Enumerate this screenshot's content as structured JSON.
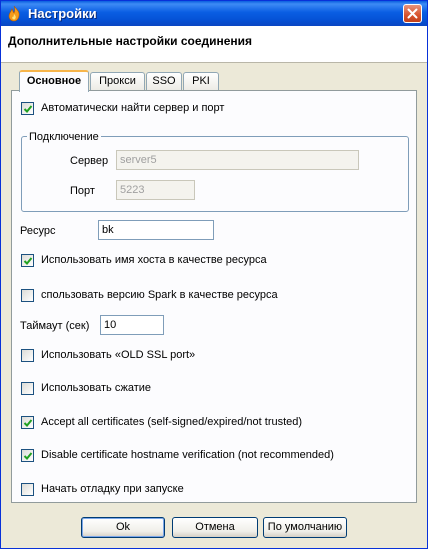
{
  "window": {
    "title": "Настройки"
  },
  "header": {
    "title": "Дополнительные настройки соединения"
  },
  "tabs": [
    {
      "label": "Основное"
    },
    {
      "label": "Прокси"
    },
    {
      "label": "SSO"
    },
    {
      "label": "PKI"
    }
  ],
  "auto_detect": {
    "label": "Автоматически найти сервер и порт",
    "checked": true
  },
  "connection": {
    "legend": "Подключение",
    "server_label": "Сервер",
    "server_value": "server5",
    "port_label": "Порт",
    "port_value": "5223"
  },
  "resource": {
    "label": "Ресурс",
    "value": "bk"
  },
  "use_hostname": {
    "label": "Использовать имя хоста в качестве ресурса",
    "checked": true
  },
  "use_spark_version": {
    "label": "спользовать версию Spark в качестве ресурса",
    "checked": false
  },
  "timeout": {
    "label": "Таймаут (сек)",
    "value": "10"
  },
  "old_ssl": {
    "label": "Использовать «OLD SSL port»",
    "checked": false
  },
  "compression": {
    "label": "Использовать сжатие",
    "checked": false
  },
  "accept_certs": {
    "label": "Accept all certificates (self-signed/expired/not trusted)",
    "checked": true
  },
  "disable_hostname_verif": {
    "label": "Disable certificate hostname verification (not recommended)",
    "checked": true
  },
  "debug_on_start": {
    "label": "Начать отладку при запуске",
    "checked": false
  },
  "buttons": {
    "ok": "Ok",
    "cancel": "Отмена",
    "defaults": "По умолчанию"
  },
  "colors": {
    "titlebar": "#0a5ee3",
    "window_bg": "#ece9d8",
    "panel_bg": "#fcfcfe",
    "tab_accent": "#f7b54a"
  }
}
